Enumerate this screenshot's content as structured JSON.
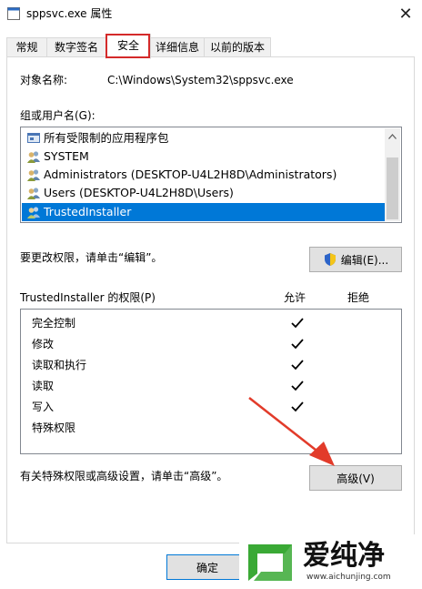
{
  "window": {
    "title": "sppsvc.exe 属性",
    "close_glyph": "✕"
  },
  "tabs": [
    {
      "label": "常规"
    },
    {
      "label": "数字签名"
    },
    {
      "label": "安全"
    },
    {
      "label": "详细信息"
    },
    {
      "label": "以前的版本"
    }
  ],
  "active_tab": "安全",
  "security": {
    "object_name_label": "对象名称:",
    "object_name_value": "C:\\Windows\\System32\\sppsvc.exe",
    "group_label": "组或用户名(G):",
    "groups": [
      {
        "name": "所有受限制的应用程序包",
        "icon": "app-package-icon"
      },
      {
        "name": "SYSTEM",
        "icon": "users-icon"
      },
      {
        "name": "Administrators (DESKTOP-U4L2H8D\\Administrators)",
        "icon": "users-icon"
      },
      {
        "name": "Users (DESKTOP-U4L2H8D\\Users)",
        "icon": "users-icon"
      },
      {
        "name": "TrustedInstaller",
        "icon": "users-icon",
        "selected": true
      }
    ],
    "change_hint": "要更改权限，请单击“编辑”。",
    "edit_button": "编辑(E)...",
    "perm_header": "TrustedInstaller 的权限(P)",
    "allow_label": "允许",
    "deny_label": "拒绝",
    "permissions": [
      {
        "name": "完全控制",
        "allow": true,
        "deny": false
      },
      {
        "name": "修改",
        "allow": true,
        "deny": false
      },
      {
        "name": "读取和执行",
        "allow": true,
        "deny": false
      },
      {
        "name": "读取",
        "allow": true,
        "deny": false
      },
      {
        "name": "写入",
        "allow": true,
        "deny": false
      },
      {
        "name": "特殊权限",
        "allow": false,
        "deny": false
      }
    ],
    "advanced_hint": "有关特殊权限或高级设置，请单击“高级”。",
    "advanced_button": "高级(V)"
  },
  "footer": {
    "ok_button": "确定"
  },
  "watermark": {
    "brand": "爱纯净",
    "url": "www.aichunjing.com"
  },
  "colors": {
    "selection": "#0078d7",
    "highlight_box": "#d42a2a",
    "arrow": "#e23b2a",
    "logo_green": "#3aa935"
  }
}
